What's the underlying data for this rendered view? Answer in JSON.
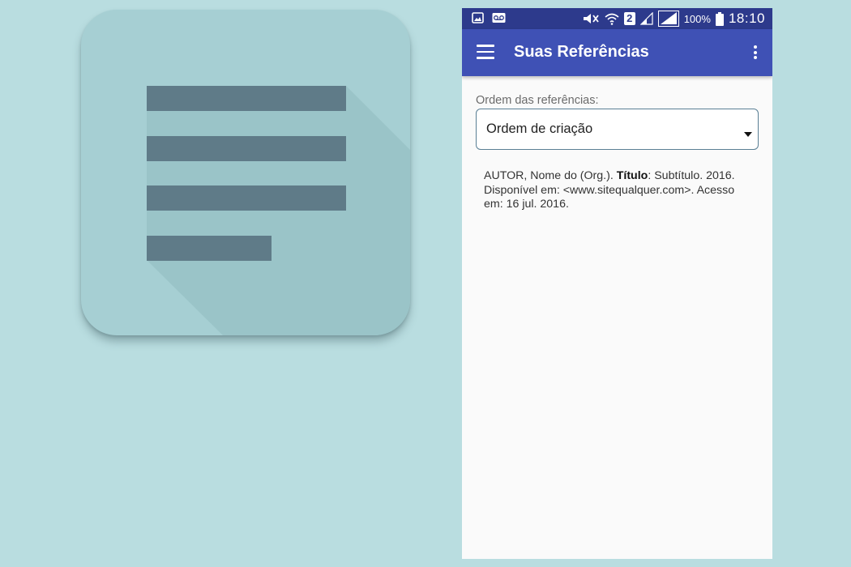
{
  "status_bar": {
    "sim": "2",
    "battery": "100%",
    "time": "18:10"
  },
  "app_bar": {
    "title": "Suas Referências"
  },
  "reference_order": {
    "label": "Ordem das referências:",
    "selected": "Ordem de criação"
  },
  "reference": {
    "author": "AUTOR, Nome do (Org.). ",
    "title": "Título",
    "rest": ": Subtítulo. 2016. Disponível em: <www.sitequalquer.com>. Acesso em: 16 jul. 2016."
  },
  "colors": {
    "background": "#b9dde0",
    "status_bar": "#2d3a8c",
    "app_bar": "#3f51b5",
    "icon_bg": "#a6cfd3",
    "icon_lines": "#5f7b88"
  },
  "icons": [
    "app-logo-icon",
    "image-icon",
    "voicemail-icon",
    "mute-icon",
    "wifi-icon",
    "signal-icon",
    "battery-icon",
    "menu-icon",
    "more-vert-icon",
    "dropdown-caret-icon"
  ]
}
